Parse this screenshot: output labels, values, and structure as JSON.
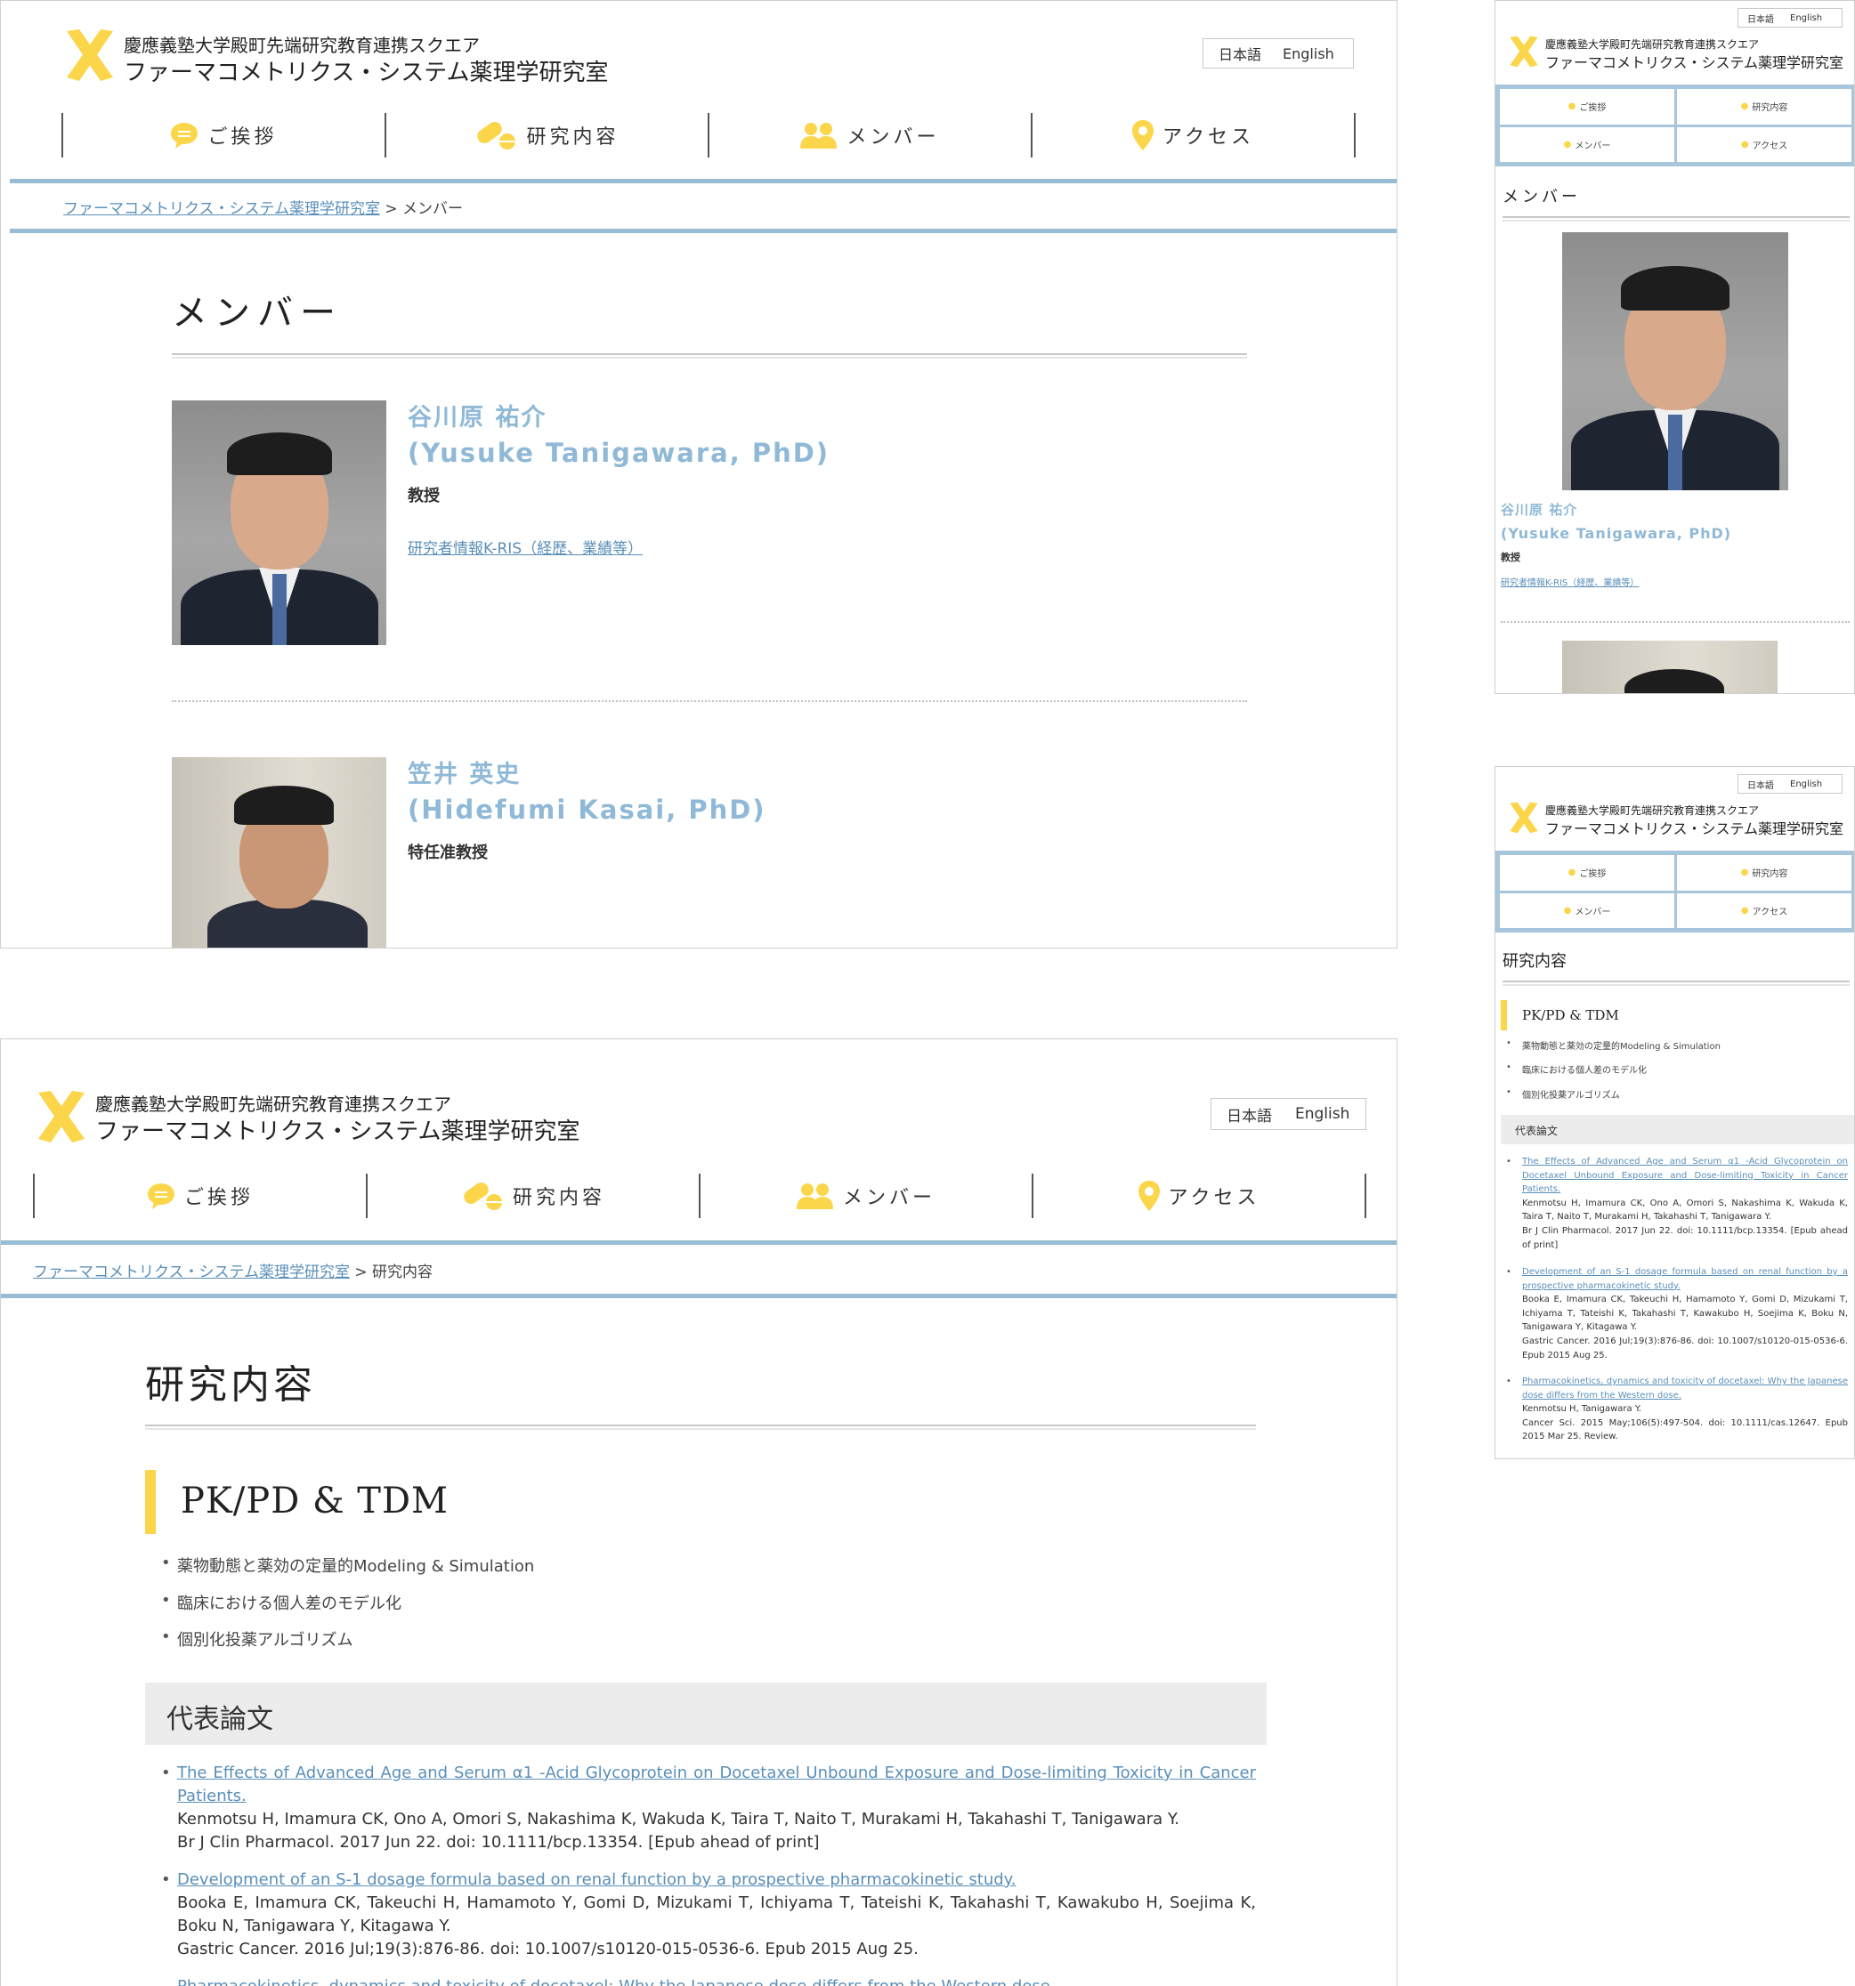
{
  "site": {
    "logo_line1": "慶應義塾大学殿町先端研究教育連携スクエア",
    "logo_line2": "ファーマコメトリクス・システム薬理学研究室",
    "lang_ja": "日本語",
    "lang_en": "English",
    "accent_yellow": "#fbd64a",
    "accent_blue": "#98bcd3",
    "link_color": "#5a8fb8"
  },
  "nav": [
    {
      "label": "ご挨拶",
      "icon": "speech-bubble-icon"
    },
    {
      "label": "研究内容",
      "icon": "pills-icon"
    },
    {
      "label": "メンバー",
      "icon": "people-icon"
    },
    {
      "label": "アクセス",
      "icon": "map-pin-icon"
    }
  ],
  "members_page": {
    "crumb_home": "ファーマコメトリクス・システム薬理学研究室",
    "crumb_sep": " > ",
    "crumb_current": "メンバー",
    "title": "メンバー",
    "members": [
      {
        "name_ja": "谷川原 祐介",
        "name_en": "(Yusuke Tanigawara, PhD)",
        "role": "教授",
        "link": "研究者情報K-RIS（経歴、業績等）"
      },
      {
        "name_ja": "笠井 英史",
        "name_en": "(Hidefumi Kasai, PhD)",
        "role": "特任准教授"
      }
    ]
  },
  "research_page": {
    "crumb_home": "ファーマコメトリクス・システム薬理学研究室",
    "crumb_sep": " > ",
    "crumb_current": "研究内容",
    "title": "研究内容",
    "section": "PK/PD & TDM",
    "bullets": [
      "薬物動態と薬効の定量的Modeling & Simulation",
      "臨床における個人差のモデル化",
      "個別化投薬アルゴリズム"
    ],
    "pub_heading": "代表論文",
    "pubs": [
      {
        "title": "The Effects of Advanced Age and Serum α1 -Acid Glycoprotein on Docetaxel Unbound Exposure and Dose-limiting Toxicity in Cancer Patients.",
        "authors": "Kenmotsu H, Imamura CK, Ono A, Omori S, Nakashima K, Wakuda K, Taira T, Naito T, Murakami H, Takahashi T, Tanigawara Y.",
        "cite": "Br J Clin Pharmacol. 2017 Jun 22. doi: 10.1111/bcp.13354. [Epub ahead of print]"
      },
      {
        "title": "Development of an S-1 dosage formula based on renal function by a prospective pharmacokinetic study.",
        "authors": "Booka E, Imamura CK, Takeuchi H, Hamamoto Y, Gomi D, Mizukami T, Ichiyama T, Tateishi K, Takahashi T, Kawakubo H, Soejima K, Boku N, Tanigawara Y, Kitagawa Y.",
        "cite": "Gastric Cancer. 2016 Jul;19(3):876-86. doi: 10.1007/s10120-015-0536-6. Epub 2015 Aug 25."
      },
      {
        "title": "Pharmacokinetics, dynamics and toxicity of docetaxel: Why the Japanese dose differs from the Western dose.",
        "authors": "Kenmotsu H, Tanigawara Y.",
        "cite": "Cancer Sci. 2015 May;106(5):497-504. doi: 10.1111/cas.12647. Epub 2015 Mar 25. Review."
      }
    ]
  }
}
